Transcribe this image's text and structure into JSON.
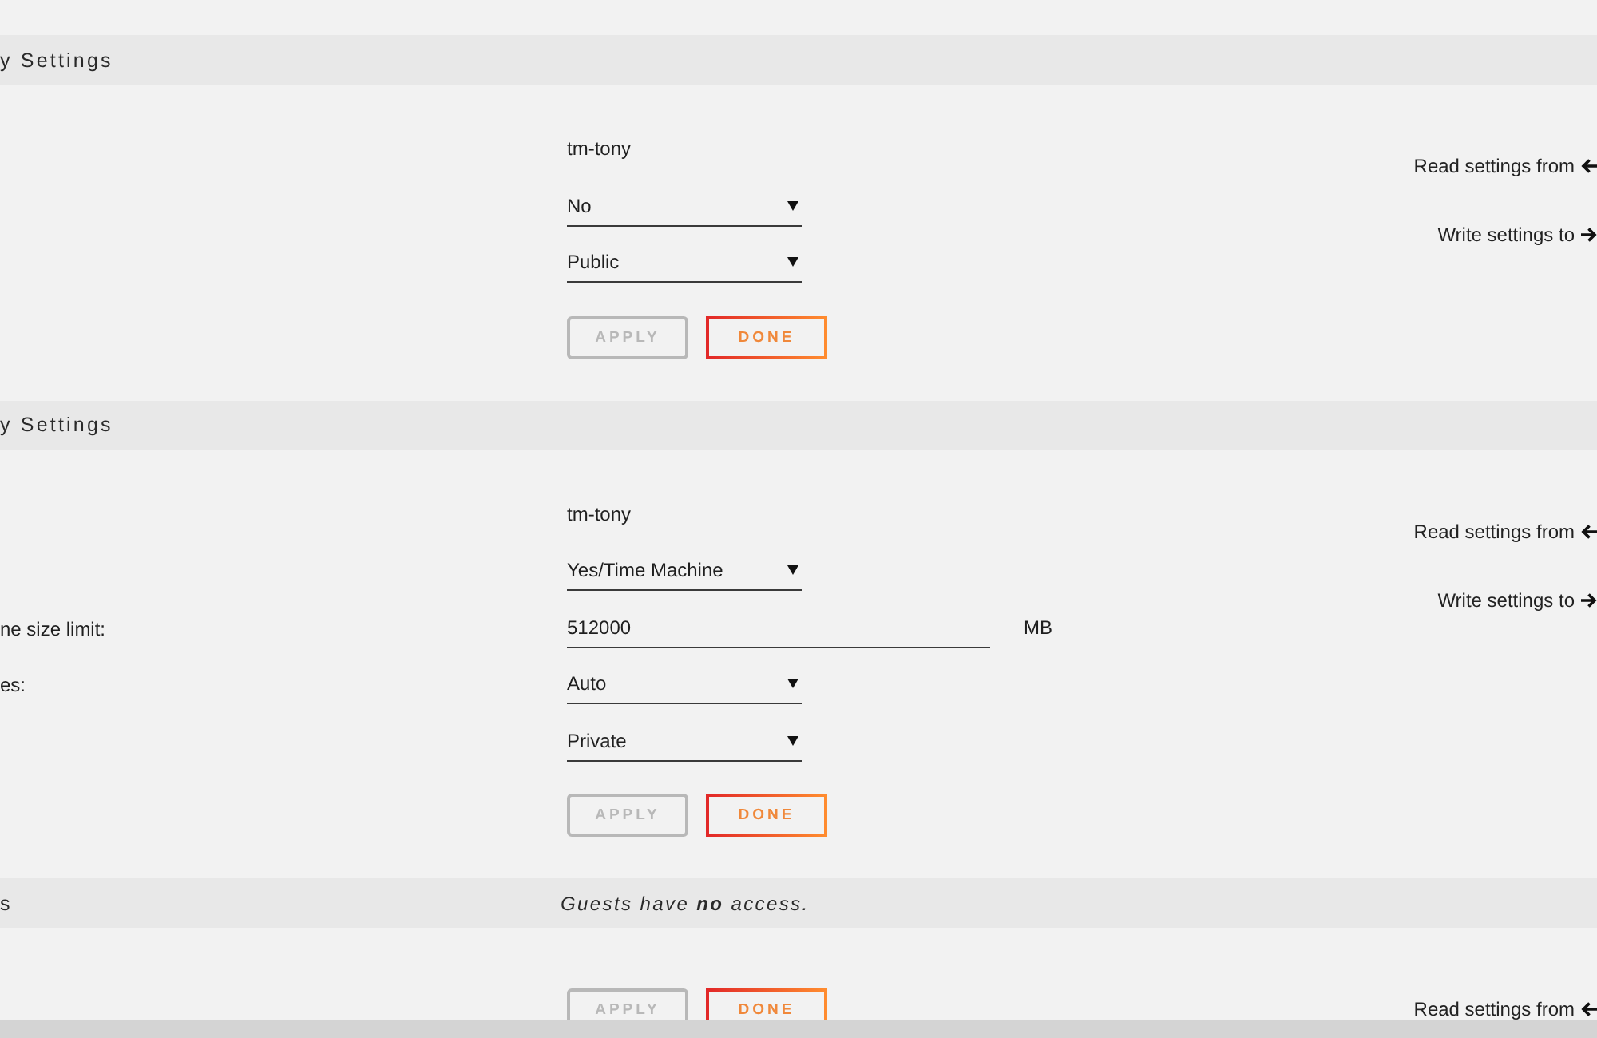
{
  "sections": [
    {
      "title": "y Settings",
      "fields": [
        {
          "kind": "text",
          "value": "tm-tony"
        },
        {
          "kind": "select",
          "value": "No"
        },
        {
          "kind": "select",
          "value": "Public"
        }
      ],
      "buttons": [
        {
          "label": "APPLY",
          "disabled": true
        },
        {
          "label": "DONE",
          "disabled": false
        }
      ],
      "side_links": [
        {
          "label": "Read settings from",
          "kind": "read"
        },
        {
          "label": "Write settings to",
          "kind": "write"
        }
      ]
    },
    {
      "title": "y Settings",
      "fields": [
        {
          "kind": "text",
          "value": "tm-tony"
        },
        {
          "kind": "select",
          "value": "Yes/Time Machine"
        },
        {
          "kind": "input",
          "label": "ne size limit:",
          "value": "512000",
          "unit": "MB"
        },
        {
          "kind": "select",
          "label": "es:",
          "value": "Auto"
        },
        {
          "kind": "select",
          "value": "Private"
        }
      ],
      "buttons": [
        {
          "label": "APPLY",
          "disabled": true
        },
        {
          "label": "DONE",
          "disabled": false
        }
      ],
      "side_links": [
        {
          "label": "Read settings from",
          "kind": "read"
        },
        {
          "label": "Write settings to",
          "kind": "write"
        }
      ]
    },
    {
      "title": "s",
      "note": "Guests have **no** access.",
      "buttons": [
        {
          "label": "APPLY",
          "disabled": true
        },
        {
          "label": "DONE",
          "disabled": false
        }
      ],
      "side_links": [
        {
          "label": "Read settings from",
          "kind": "read"
        }
      ]
    }
  ]
}
